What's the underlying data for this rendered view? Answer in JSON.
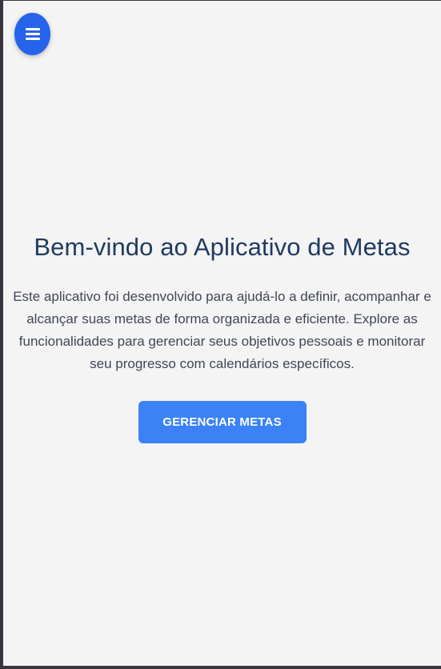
{
  "menu": {
    "icon": "hamburger-menu-icon",
    "color": "#2563eb"
  },
  "main": {
    "title": "Bem-vindo ao Aplicativo de Metas",
    "description": "Este aplicativo foi desenvolvido para ajudá-lo a definir, acompanhar e alcançar suas metas de forma organizada e eficiente. Explore as funcionalidades para gerenciar seus objetivos pessoais e monitorar seu progresso com calendários específicos.",
    "cta_label": "GERENCIAR METAS",
    "cta_color": "#3b82f6"
  }
}
